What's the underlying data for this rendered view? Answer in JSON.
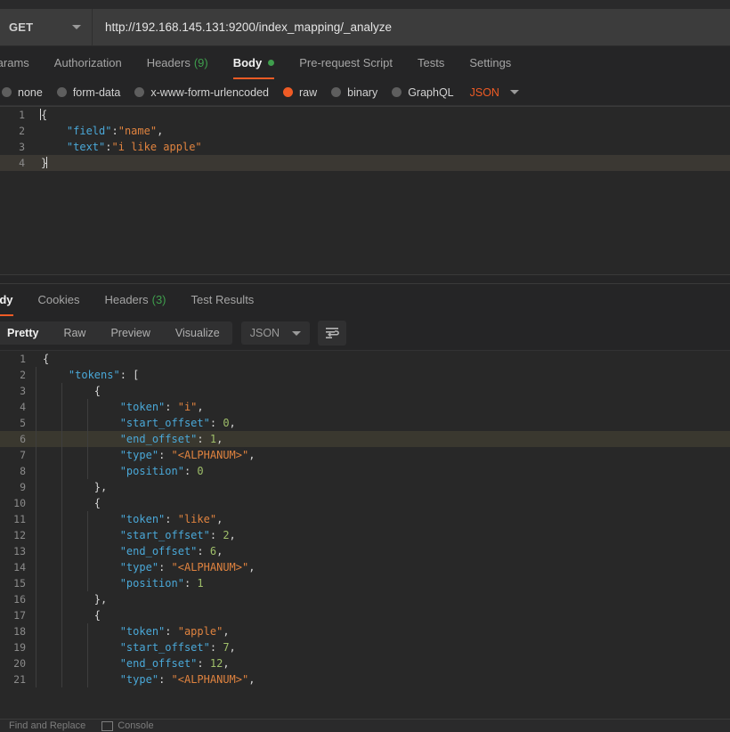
{
  "request": {
    "method": "GET",
    "url": "http://192.168.145.131:9200/index_mapping/_analyze",
    "tabs": [
      {
        "label": "Params",
        "count": "",
        "active": false
      },
      {
        "label": "Authorization",
        "count": "",
        "active": false
      },
      {
        "label": "Headers",
        "count": "(9)",
        "active": false
      },
      {
        "label": "Body",
        "count": "",
        "active": true,
        "dot": true
      },
      {
        "label": "Pre-request Script",
        "count": "",
        "active": false
      },
      {
        "label": "Tests",
        "count": "",
        "active": false
      },
      {
        "label": "Settings",
        "count": "",
        "active": false
      }
    ],
    "body_types": [
      {
        "label": "none",
        "selected": false
      },
      {
        "label": "form-data",
        "selected": false
      },
      {
        "label": "x-www-form-urlencoded",
        "selected": false
      },
      {
        "label": "raw",
        "selected": true
      },
      {
        "label": "binary",
        "selected": false
      },
      {
        "label": "GraphQL",
        "selected": false
      }
    ],
    "format": "JSON",
    "body_lines": [
      {
        "n": "1",
        "highlight": false,
        "cursor_start": true,
        "tokens": [
          {
            "t": "punc",
            "v": "{"
          }
        ]
      },
      {
        "n": "2",
        "highlight": false,
        "tokens": [
          {
            "t": "plain",
            "v": "    "
          },
          {
            "t": "key",
            "v": "\"field\""
          },
          {
            "t": "punc",
            "v": ":"
          },
          {
            "t": "str",
            "v": "\"name\""
          },
          {
            "t": "punc",
            "v": ","
          }
        ]
      },
      {
        "n": "3",
        "highlight": false,
        "tokens": [
          {
            "t": "plain",
            "v": "    "
          },
          {
            "t": "key",
            "v": "\"text\""
          },
          {
            "t": "punc",
            "v": ":"
          },
          {
            "t": "str",
            "v": "\"i like apple\""
          }
        ]
      },
      {
        "n": "4",
        "highlight": true,
        "cursor_end": true,
        "tokens": [
          {
            "t": "punc",
            "v": "}"
          }
        ]
      }
    ]
  },
  "response": {
    "tabs": [
      {
        "label": "Body",
        "count": "",
        "active": true
      },
      {
        "label": "Cookies",
        "count": "",
        "active": false
      },
      {
        "label": "Headers",
        "count": "(3)",
        "active": false
      },
      {
        "label": "Test Results",
        "count": "",
        "active": false
      }
    ],
    "view_modes": [
      {
        "label": "Pretty",
        "active": true
      },
      {
        "label": "Raw",
        "active": false
      },
      {
        "label": "Preview",
        "active": false
      },
      {
        "label": "Visualize",
        "active": false
      }
    ],
    "format": "JSON",
    "wrap_icon": "word-wrap-icon",
    "body_lines": [
      {
        "n": "1",
        "highlight": false,
        "guides": [],
        "tokens": [
          {
            "t": "punc",
            "v": "{"
          }
        ]
      },
      {
        "n": "2",
        "highlight": false,
        "guides": [
          0
        ],
        "tokens": [
          {
            "t": "plain",
            "v": "    "
          },
          {
            "t": "key",
            "v": "\"tokens\""
          },
          {
            "t": "punc",
            "v": ": ["
          }
        ]
      },
      {
        "n": "3",
        "highlight": false,
        "guides": [
          0,
          1
        ],
        "tokens": [
          {
            "t": "plain",
            "v": "        "
          },
          {
            "t": "punc",
            "v": "{"
          }
        ]
      },
      {
        "n": "4",
        "highlight": false,
        "guides": [
          0,
          1,
          2
        ],
        "tokens": [
          {
            "t": "plain",
            "v": "            "
          },
          {
            "t": "key",
            "v": "\"token\""
          },
          {
            "t": "punc",
            "v": ": "
          },
          {
            "t": "str",
            "v": "\"i\""
          },
          {
            "t": "punc",
            "v": ","
          }
        ]
      },
      {
        "n": "5",
        "highlight": false,
        "guides": [
          0,
          1,
          2
        ],
        "tokens": [
          {
            "t": "plain",
            "v": "            "
          },
          {
            "t": "key",
            "v": "\"start_offset\""
          },
          {
            "t": "punc",
            "v": ": "
          },
          {
            "t": "num",
            "v": "0"
          },
          {
            "t": "punc",
            "v": ","
          }
        ]
      },
      {
        "n": "6",
        "highlight": true,
        "guides": [
          0,
          1,
          2
        ],
        "tokens": [
          {
            "t": "plain",
            "v": "            "
          },
          {
            "t": "key",
            "v": "\"end_offset\""
          },
          {
            "t": "punc",
            "v": ": "
          },
          {
            "t": "num",
            "v": "1"
          },
          {
            "t": "punc",
            "v": ","
          }
        ]
      },
      {
        "n": "7",
        "highlight": false,
        "guides": [
          0,
          1,
          2
        ],
        "tokens": [
          {
            "t": "plain",
            "v": "            "
          },
          {
            "t": "key",
            "v": "\"type\""
          },
          {
            "t": "punc",
            "v": ": "
          },
          {
            "t": "str",
            "v": "\"<ALPHANUM>\""
          },
          {
            "t": "punc",
            "v": ","
          }
        ]
      },
      {
        "n": "8",
        "highlight": false,
        "guides": [
          0,
          1,
          2
        ],
        "tokens": [
          {
            "t": "plain",
            "v": "            "
          },
          {
            "t": "key",
            "v": "\"position\""
          },
          {
            "t": "punc",
            "v": ": "
          },
          {
            "t": "num",
            "v": "0"
          }
        ]
      },
      {
        "n": "9",
        "highlight": false,
        "guides": [
          0,
          1
        ],
        "tokens": [
          {
            "t": "plain",
            "v": "        "
          },
          {
            "t": "punc",
            "v": "},"
          }
        ]
      },
      {
        "n": "10",
        "highlight": false,
        "guides": [
          0,
          1
        ],
        "tokens": [
          {
            "t": "plain",
            "v": "        "
          },
          {
            "t": "punc",
            "v": "{"
          }
        ]
      },
      {
        "n": "11",
        "highlight": false,
        "guides": [
          0,
          1,
          2
        ],
        "tokens": [
          {
            "t": "plain",
            "v": "            "
          },
          {
            "t": "key",
            "v": "\"token\""
          },
          {
            "t": "punc",
            "v": ": "
          },
          {
            "t": "str",
            "v": "\"like\""
          },
          {
            "t": "punc",
            "v": ","
          }
        ]
      },
      {
        "n": "12",
        "highlight": false,
        "guides": [
          0,
          1,
          2
        ],
        "tokens": [
          {
            "t": "plain",
            "v": "            "
          },
          {
            "t": "key",
            "v": "\"start_offset\""
          },
          {
            "t": "punc",
            "v": ": "
          },
          {
            "t": "num",
            "v": "2"
          },
          {
            "t": "punc",
            "v": ","
          }
        ]
      },
      {
        "n": "13",
        "highlight": false,
        "guides": [
          0,
          1,
          2
        ],
        "tokens": [
          {
            "t": "plain",
            "v": "            "
          },
          {
            "t": "key",
            "v": "\"end_offset\""
          },
          {
            "t": "punc",
            "v": ": "
          },
          {
            "t": "num",
            "v": "6"
          },
          {
            "t": "punc",
            "v": ","
          }
        ]
      },
      {
        "n": "14",
        "highlight": false,
        "guides": [
          0,
          1,
          2
        ],
        "tokens": [
          {
            "t": "plain",
            "v": "            "
          },
          {
            "t": "key",
            "v": "\"type\""
          },
          {
            "t": "punc",
            "v": ": "
          },
          {
            "t": "str",
            "v": "\"<ALPHANUM>\""
          },
          {
            "t": "punc",
            "v": ","
          }
        ]
      },
      {
        "n": "15",
        "highlight": false,
        "guides": [
          0,
          1,
          2
        ],
        "tokens": [
          {
            "t": "plain",
            "v": "            "
          },
          {
            "t": "key",
            "v": "\"position\""
          },
          {
            "t": "punc",
            "v": ": "
          },
          {
            "t": "num",
            "v": "1"
          }
        ]
      },
      {
        "n": "16",
        "highlight": false,
        "guides": [
          0,
          1
        ],
        "tokens": [
          {
            "t": "plain",
            "v": "        "
          },
          {
            "t": "punc",
            "v": "},"
          }
        ]
      },
      {
        "n": "17",
        "highlight": false,
        "guides": [
          0,
          1
        ],
        "tokens": [
          {
            "t": "plain",
            "v": "        "
          },
          {
            "t": "punc",
            "v": "{"
          }
        ]
      },
      {
        "n": "18",
        "highlight": false,
        "guides": [
          0,
          1,
          2
        ],
        "tokens": [
          {
            "t": "plain",
            "v": "            "
          },
          {
            "t": "key",
            "v": "\"token\""
          },
          {
            "t": "punc",
            "v": ": "
          },
          {
            "t": "str",
            "v": "\"apple\""
          },
          {
            "t": "punc",
            "v": ","
          }
        ]
      },
      {
        "n": "19",
        "highlight": false,
        "guides": [
          0,
          1,
          2
        ],
        "tokens": [
          {
            "t": "plain",
            "v": "            "
          },
          {
            "t": "key",
            "v": "\"start_offset\""
          },
          {
            "t": "punc",
            "v": ": "
          },
          {
            "t": "num",
            "v": "7"
          },
          {
            "t": "punc",
            "v": ","
          }
        ]
      },
      {
        "n": "20",
        "highlight": false,
        "guides": [
          0,
          1,
          2
        ],
        "tokens": [
          {
            "t": "plain",
            "v": "            "
          },
          {
            "t": "key",
            "v": "\"end_offset\""
          },
          {
            "t": "punc",
            "v": ": "
          },
          {
            "t": "num",
            "v": "12"
          },
          {
            "t": "punc",
            "v": ","
          }
        ]
      },
      {
        "n": "21",
        "highlight": false,
        "guides": [
          0,
          1,
          2
        ],
        "tokens": [
          {
            "t": "plain",
            "v": "            "
          },
          {
            "t": "key",
            "v": "\"type\""
          },
          {
            "t": "punc",
            "v": ": "
          },
          {
            "t": "str",
            "v": "\"<ALPHANUM>\""
          },
          {
            "t": "punc",
            "v": ","
          }
        ]
      }
    ]
  },
  "footer": {
    "items": [
      {
        "label": "Find and Replace",
        "icon": ""
      },
      {
        "label": "Console",
        "icon": "console-icon"
      }
    ]
  },
  "colors": {
    "accent": "#ef5b25",
    "green": "#3f9e4d",
    "key": "#4aa8d8",
    "string": "#e0833f",
    "number": "#9fbf6a",
    "editor_bg": "#282828",
    "panel_bg": "#252526"
  }
}
